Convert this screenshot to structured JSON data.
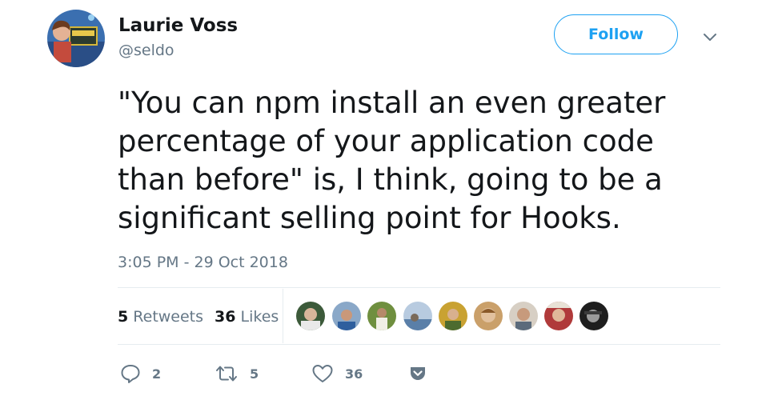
{
  "author": {
    "display_name": "Laurie Voss",
    "handle": "@seldo"
  },
  "follow_label": "Follow",
  "tweet": {
    "text": "\"You can npm install an even greater percentage of your application code than before\" is, I think, going to be a significant selling point for Hooks.",
    "timestamp": "3:05 PM - 29 Oct 2018"
  },
  "stats": {
    "retweets_count": "5",
    "retweets_label": "Retweets",
    "likes_count": "36",
    "likes_label": "Likes"
  },
  "actions": {
    "reply_count": "2",
    "retweet_count": "5",
    "like_count": "36"
  },
  "colors": {
    "accent": "#1da1f2",
    "muted": "#657786",
    "text": "#14171a",
    "divider": "#e6ecf0"
  },
  "icons": [
    "reply-icon",
    "retweet-icon",
    "heart-icon",
    "pocket-icon",
    "chevron-down-icon"
  ]
}
